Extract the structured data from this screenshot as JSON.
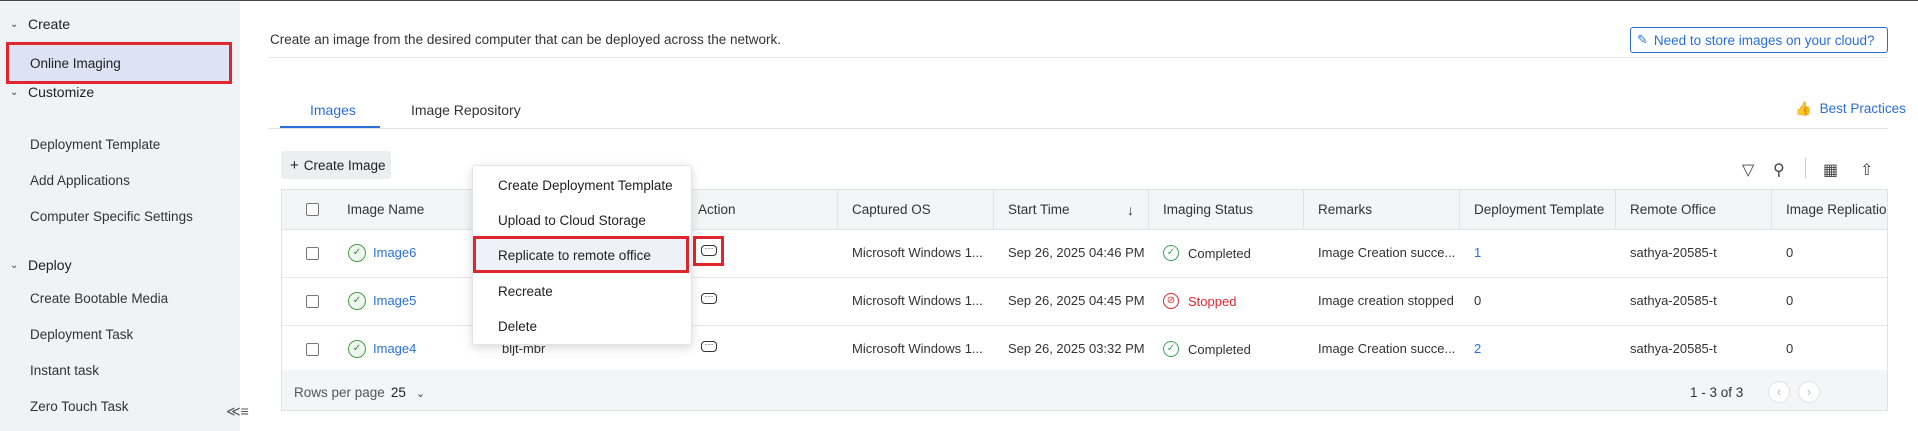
{
  "sidebar": {
    "groups": [
      {
        "label": "Create",
        "items": [
          "Online Imaging"
        ]
      },
      {
        "label": "Customize",
        "items": [
          "Deployment Template",
          "Add Applications",
          "Computer Specific Settings"
        ]
      },
      {
        "label": "Deploy",
        "items": [
          "Create Bootable Media",
          "Deployment Task",
          "Instant task",
          "Zero Touch Task"
        ]
      }
    ],
    "active_item": "Online Imaging"
  },
  "main": {
    "info_text": "Create an image from the desired computer that can be deployed across the network.",
    "cloud_button": "Need to store images on your cloud?",
    "tabs": [
      {
        "label": "Images",
        "active": true
      },
      {
        "label": "Image Repository",
        "active": false
      }
    ],
    "best_practices": "Best Practices",
    "create_image_button": "Create Image"
  },
  "table": {
    "columns": [
      "Image Name",
      "Action",
      "Captured OS",
      "Start Time",
      "Imaging Status",
      "Remarks",
      "Deployment Template",
      "Remote Office",
      "Image Replicatio"
    ],
    "rows": [
      {
        "name": "Image6",
        "os": "Microsoft Windows 1...",
        "start": "Sep 26, 2025 04:46 PM",
        "status": "Completed",
        "status_type": "ok",
        "remarks": "Image Creation succe...",
        "template": "1",
        "template_link": true,
        "office": "sathya-20585-t",
        "replication": "0"
      },
      {
        "name": "Image5",
        "os": "Microsoft Windows 1...",
        "start": "Sep 26, 2025 04:45 PM",
        "status": "Stopped",
        "status_type": "stop",
        "remarks": "Image creation stopped",
        "template": "0",
        "template_link": false,
        "office": "sathya-20585-t",
        "replication": "0"
      },
      {
        "name": "Image4",
        "computer": "bljt-mbr",
        "os": "Microsoft Windows 1...",
        "start": "Sep 26, 2025 03:32 PM",
        "status": "Completed",
        "status_type": "ok",
        "remarks": "Image Creation succe...",
        "template": "2",
        "template_link": true,
        "office": "sathya-20585-t",
        "replication": "0"
      }
    ],
    "footer": {
      "rows_per_page_label": "Rows per page",
      "rows_per_page": "25",
      "range": "1 - 3 of 3"
    }
  },
  "context_menu": {
    "items": [
      "Create Deployment Template",
      "Upload to Cloud Storage",
      "Replicate to remote office",
      "Recreate",
      "Delete"
    ],
    "highlighted": "Replicate to remote office"
  },
  "colors": {
    "accent": "#2a6fd6",
    "highlight": "#e0262d",
    "success": "#3aa35a"
  }
}
